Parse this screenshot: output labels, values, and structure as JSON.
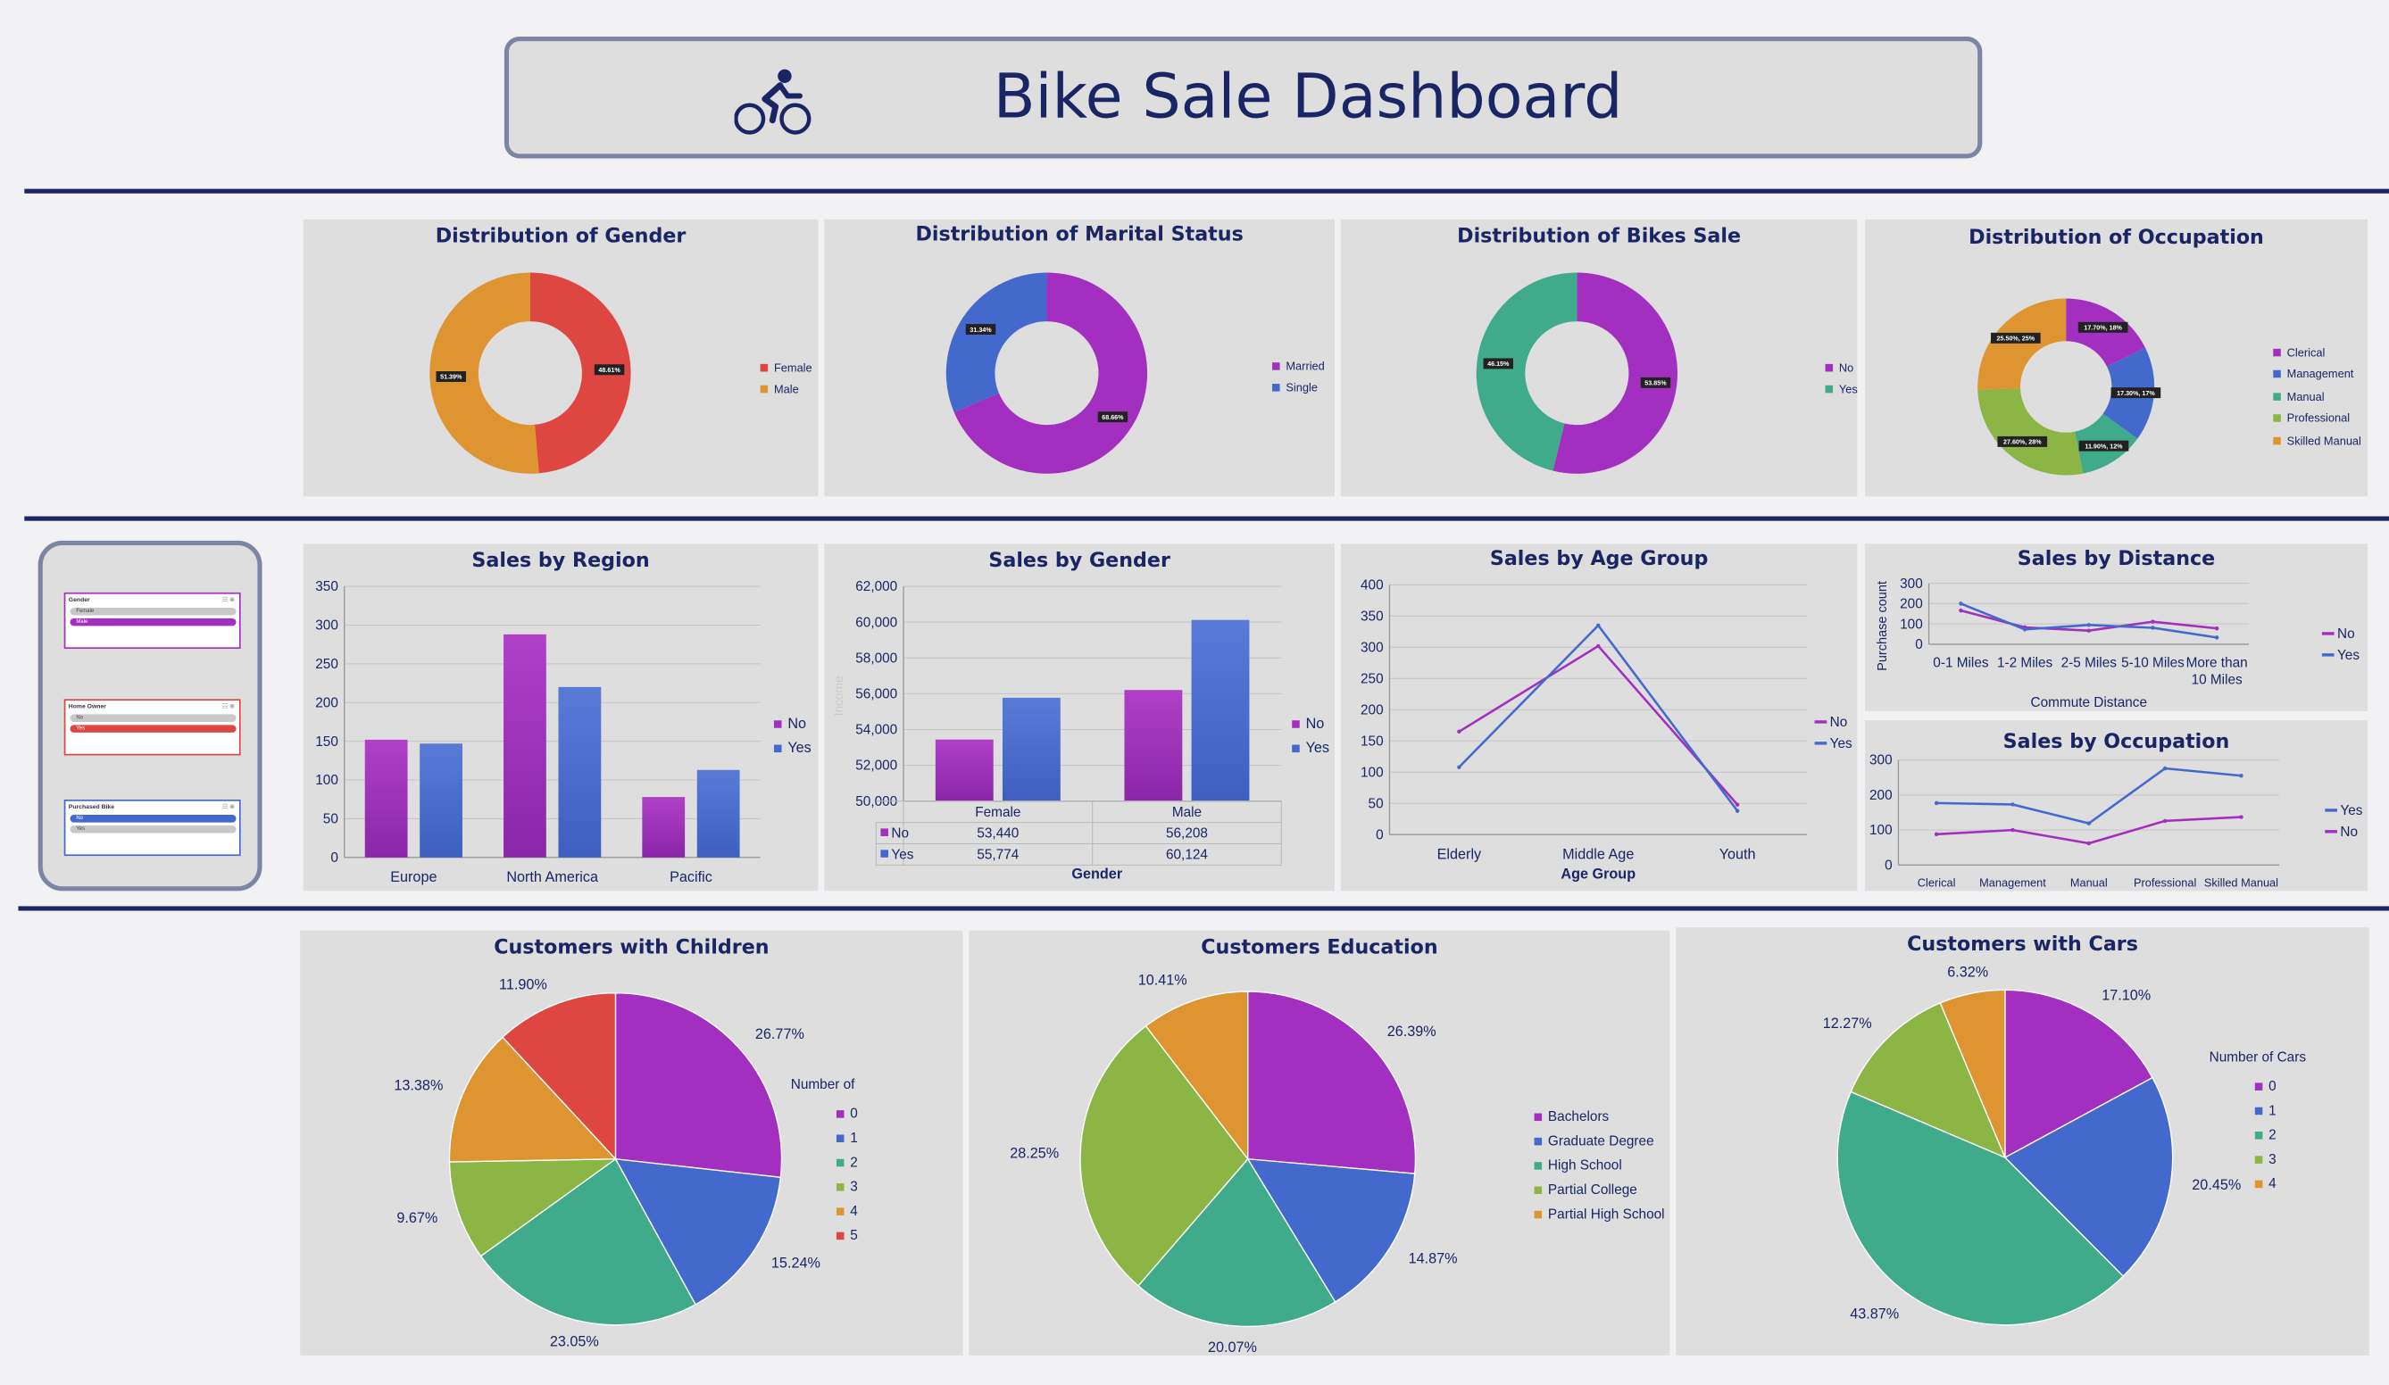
{
  "dashboard": {
    "title": "Bike Sale Dashboard"
  },
  "colors": {
    "navy": "#1a2566",
    "purple": "#a22fc0",
    "blue": "#4469cc",
    "teal": "#40ab8b",
    "green": "#8bb545",
    "orange": "#de9431",
    "red": "#de4741"
  },
  "slicers": [
    {
      "title": "Gender",
      "items": [
        "Female",
        "Male"
      ],
      "selected": "Male",
      "accent": "#a22fc0"
    },
    {
      "title": "Home Owner",
      "items": [
        "No",
        "Yes"
      ],
      "selected": "Yes",
      "accent": "#de4741"
    },
    {
      "title": "Purchased Bike",
      "items": [
        "No",
        "Yes"
      ],
      "selected": "No",
      "accent": "#4469cc"
    }
  ],
  "chart_data": [
    {
      "id": "gender",
      "type": "pie",
      "variant": "donut",
      "title": "Distribution of Gender",
      "labels": [
        "Female",
        "Male"
      ],
      "values": [
        48.61,
        51.39
      ],
      "data_labels": [
        "48.61%",
        "51.39%"
      ],
      "colors": [
        "#de4741",
        "#de9431"
      ]
    },
    {
      "id": "marital",
      "type": "pie",
      "variant": "donut",
      "title": "Distribution of Marital Status",
      "labels": [
        "Married",
        "Single"
      ],
      "values": [
        68.66,
        31.34
      ],
      "data_labels": [
        "68.66%",
        "31.34%"
      ],
      "colors": [
        "#a22fc0",
        "#4469cc"
      ]
    },
    {
      "id": "bikes",
      "type": "pie",
      "variant": "donut",
      "title": "Distribution of  Bikes Sale",
      "labels": [
        "No",
        "Yes"
      ],
      "values": [
        53.85,
        46.15
      ],
      "data_labels": [
        "53.85%",
        "46.15%"
      ],
      "colors": [
        "#a22fc0",
        "#40ab8b"
      ]
    },
    {
      "id": "occupation",
      "type": "pie",
      "variant": "donut",
      "title": "Distribution of  Occupation",
      "labels": [
        "Clerical",
        "Management",
        "Manual",
        "Professional",
        "Skilled Manual"
      ],
      "values": [
        17.7,
        17.3,
        11.9,
        27.6,
        25.5
      ],
      "data_labels": [
        "17.70%, 18%",
        "17.30%, 17%",
        "11.90%, 12%",
        "27.60%, 28%",
        "25.50%, 25%"
      ],
      "colors": [
        "#a22fc0",
        "#4469cc",
        "#40ab8b",
        "#8bb545",
        "#de9431"
      ]
    },
    {
      "id": "region",
      "type": "bar",
      "title": "Sales by Region",
      "categories": [
        "Europe",
        "North America",
        "Pacific"
      ],
      "series": [
        {
          "name": "No",
          "values": [
            152,
            288,
            78
          ]
        },
        {
          "name": "Yes",
          "values": [
            147,
            220,
            113
          ]
        }
      ],
      "ylim": [
        0,
        350
      ],
      "yticks": [
        0,
        50,
        100,
        150,
        200,
        250,
        300,
        350
      ]
    },
    {
      "id": "salesgender",
      "type": "bar",
      "title": "Sales by Gender",
      "xlabel": "Gender",
      "ylabel": "Income",
      "categories": [
        "Female",
        "Male"
      ],
      "series": [
        {
          "name": "No",
          "values": [
            53440,
            56208
          ],
          "table": [
            "53,440",
            "56,208"
          ]
        },
        {
          "name": "Yes",
          "values": [
            55774,
            60124
          ],
          "table": [
            "55,774",
            "60,124"
          ]
        }
      ],
      "ylim": [
        50000,
        62000
      ],
      "yticks": [
        "50,000",
        "52,000",
        "54,000",
        "56,000",
        "58,000",
        "60,000",
        "62,000"
      ]
    },
    {
      "id": "age",
      "type": "line",
      "title": "Sales by Age Group",
      "xlabel": "Age Group",
      "categories": [
        "Elderly",
        "Middle Age",
        "Youth"
      ],
      "series": [
        {
          "name": "No",
          "values": [
            165,
            302,
            48
          ]
        },
        {
          "name": "Yes",
          "values": [
            108,
            335,
            38
          ]
        }
      ],
      "ylim": [
        0,
        400
      ],
      "yticks": [
        0,
        50,
        100,
        150,
        200,
        250,
        300,
        350,
        400
      ]
    },
    {
      "id": "distance",
      "type": "line",
      "title": "Sales by Distance",
      "xlabel": "Commute Distance",
      "ylabel": "Purchase count",
      "categories": [
        "0-1 Miles",
        "1-2 Miles",
        "2-5 Miles",
        "5-10 Miles",
        "More than 10 Miles"
      ],
      "series": [
        {
          "name": "No",
          "values": [
            166,
            83,
            67,
            111,
            78
          ]
        },
        {
          "name": "Yes",
          "values": [
            200,
            73,
            95,
            81,
            33
          ]
        }
      ],
      "ylim": [
        0,
        300
      ],
      "yticks": [
        0,
        100,
        200,
        300
      ]
    },
    {
      "id": "occsales",
      "type": "line",
      "title": "Sales by Occupation",
      "categories": [
        "Clerical",
        "Management",
        "Manual",
        "Professional",
        "Skilled Manual"
      ],
      "series": [
        {
          "name": "Yes",
          "values": [
            177,
            173,
            119,
            276,
            255
          ]
        },
        {
          "name": "No",
          "values": [
            88,
            100,
            62,
            126,
            137
          ]
        }
      ],
      "ylim": [
        0,
        300
      ],
      "yticks": [
        0,
        100,
        200,
        300
      ]
    },
    {
      "id": "children",
      "type": "pie",
      "title": "Customers with Children",
      "legend_title": "Number of",
      "labels": [
        "0",
        "1",
        "2",
        "3",
        "4",
        "5"
      ],
      "values": [
        26.77,
        15.24,
        23.05,
        9.67,
        13.38,
        11.9
      ],
      "data_labels": [
        "26.77%",
        "15.24%",
        "23.05%",
        "9.67%",
        "13.38%",
        "11.90%"
      ],
      "colors": [
        "#a22fc0",
        "#4469cc",
        "#40ab8b",
        "#8bb545",
        "#de9431",
        "#de4741"
      ]
    },
    {
      "id": "education",
      "type": "pie",
      "title": "Customers Education",
      "labels": [
        "Bachelors",
        "Graduate Degree",
        "High School",
        "Partial College",
        "Partial High School"
      ],
      "values": [
        26.39,
        14.87,
        20.07,
        28.25,
        10.41
      ],
      "data_labels": [
        "26.39%",
        "14.87%",
        "20.07%",
        "28.25%",
        "10.41%"
      ],
      "colors": [
        "#a22fc0",
        "#4469cc",
        "#40ab8b",
        "#8bb545",
        "#de9431"
      ]
    },
    {
      "id": "cars",
      "type": "pie",
      "title": "Customers with Cars",
      "legend_title": "Number of Cars",
      "labels": [
        "0",
        "1",
        "2",
        "3",
        "4"
      ],
      "values": [
        17.1,
        20.45,
        43.87,
        12.27,
        6.32
      ],
      "data_labels": [
        "17.10%",
        "20.45%",
        "43.87%",
        "12.27%",
        "6.32%"
      ],
      "colors": [
        "#a22fc0",
        "#4469cc",
        "#40ab8b",
        "#8bb545",
        "#de9431"
      ]
    }
  ]
}
